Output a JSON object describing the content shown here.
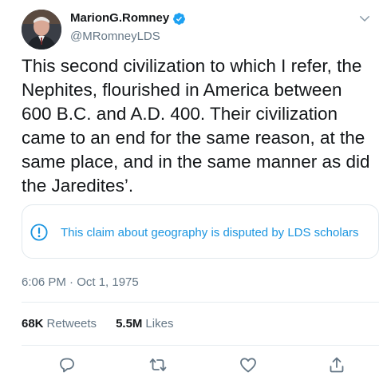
{
  "author": {
    "display_name": "MarionG.Romney",
    "handle": "@MRomneyLDS",
    "verified": true
  },
  "tweet": {
    "text": "This second civilization to which I refer, the Nephites, flourished in America between 600 B.C. and A.D. 400. Their civilization came to an end for the same reason, at the same place, and in the same manner as did the Jaredites’.",
    "notice": "This claim about geography is disputed by LDS scholars",
    "timestamp": "6:06 PM · Oct 1, 1975"
  },
  "stats": {
    "retweets_count": "68K",
    "retweets_label": "Retweets",
    "likes_count": "5.5M",
    "likes_label": "Likes"
  },
  "actions": [
    "reply-icon",
    "retweet-icon",
    "like-icon",
    "share-icon"
  ],
  "colors": {
    "text": "#14171a",
    "secondary": "#657786",
    "accent": "#1b95e0",
    "border": "#e1e8ed"
  }
}
